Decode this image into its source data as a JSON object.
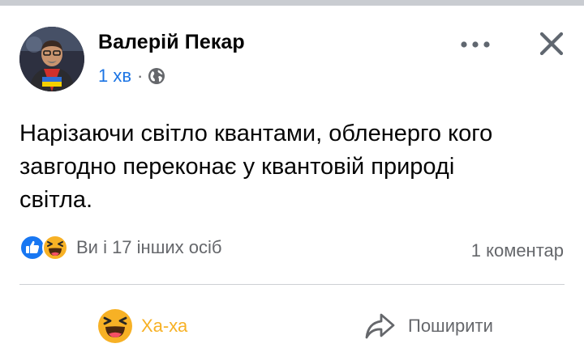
{
  "post": {
    "author": "Валерій Пекар",
    "timestamp": "1 хв",
    "separator": "·",
    "privacy_icon": "globe-icon",
    "text_lines": [
      "Нарізаючи світло квантами, обленерго кого",
      "завгодно переконає у квантовій природі",
      "світла."
    ],
    "reactions": {
      "icons": [
        "like-icon",
        "haha-icon"
      ],
      "summary": "Ви і 17 інших осіб"
    },
    "comments": "1 коментар",
    "actions": {
      "reaction_label": "Ха-ха",
      "share_label": "Поширити"
    }
  },
  "colors": {
    "link_blue": "#1b74e4",
    "meta_gray": "#65676b",
    "haha_yellow": "#f7b125",
    "divider": "#ced0d4",
    "text": "#050505"
  }
}
